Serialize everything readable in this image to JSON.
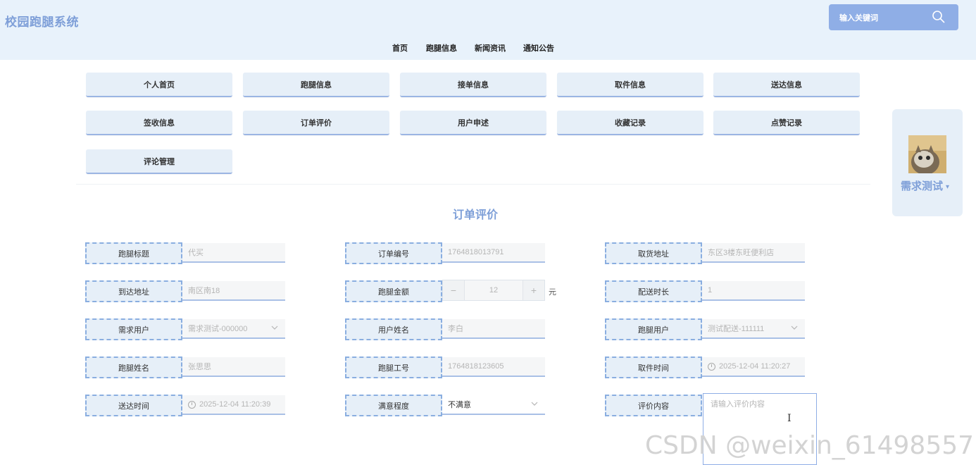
{
  "brand": "校园跑腿系统",
  "search": {
    "placeholder": "输入关键词"
  },
  "nav": [
    "首页",
    "跑腿信息",
    "新闻资讯",
    "通知公告"
  ],
  "menu": [
    "个人首页",
    "跑腿信息",
    "接单信息",
    "取件信息",
    "送达信息",
    "签收信息",
    "订单评价",
    "用户申述",
    "收藏记录",
    "点赞记录",
    "评论管理"
  ],
  "user": {
    "name": "需求测试",
    "caret": "▾"
  },
  "form": {
    "title": "订单评价",
    "fields": {
      "title_label": "跑腿标题",
      "title_value": "代买",
      "order_label": "订单编号",
      "order_value": "1764818013791",
      "pickup_label": "取货地址",
      "pickup_value": "东区3楼东旺便利店",
      "dest_label": "到达地址",
      "dest_value": "南区南18",
      "amount_label": "跑腿金额",
      "amount_value": "12",
      "amount_unit": "元",
      "amount_minus": "−",
      "amount_plus": "+",
      "duration_label": "配送时长",
      "duration_value": "1",
      "requester_label": "需求用户",
      "requester_value": "需求测试-000000",
      "username_label": "用户姓名",
      "username_value": "李白",
      "runner_label": "跑腿用户",
      "runner_value": "测试配送-111111",
      "runnername_label": "跑腿姓名",
      "runnername_value": "张思思",
      "runnerid_label": "跑腿工号",
      "runnerid_value": "1764818123605",
      "pickuptime_label": "取件时间",
      "pickuptime_value": "2025-12-04 11:20:27",
      "delivery_label": "送达时间",
      "delivery_value": "2025-12-04 11:20:39",
      "satisfaction_label": "满意程度",
      "satisfaction_value": "不满意",
      "review_label": "评价内容",
      "review_placeholder": "请输入评价内容"
    }
  },
  "watermark": "CSDN @weixin_61498557",
  "colors": {
    "accent": "#7e9fd8",
    "header_bg": "#e8f2fb",
    "button_bg": "#e6eff8",
    "search_bg": "#8faee6"
  },
  "icons": [
    "search-icon",
    "chevron-down-icon",
    "clock-icon",
    "text-cursor-icon"
  ]
}
